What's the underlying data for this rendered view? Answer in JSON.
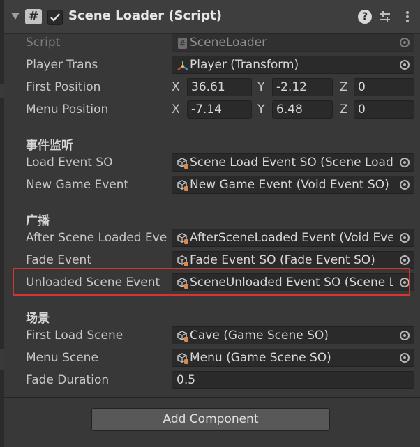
{
  "component": {
    "title": "Scene Loader (Script)",
    "script_icon_glyph": "#",
    "enabled": true,
    "header_icons": [
      "help-icon",
      "presets-icon",
      "kebab-menu-icon"
    ]
  },
  "fields": {
    "script": {
      "label": "Script",
      "value": "SceneLoader",
      "icon": "script-icon"
    },
    "player_trans": {
      "label": "Player Trans",
      "value": "Player (Transform)",
      "icon": "transform-icon"
    },
    "first_position": {
      "label": "First Position",
      "x_label": "X",
      "x": "36.61",
      "y_label": "Y",
      "y": "-2.12",
      "z_label": "Z",
      "z": "0"
    },
    "menu_position": {
      "label": "Menu Position",
      "x_label": "X",
      "x": "-7.14",
      "y_label": "Y",
      "y": "6.48",
      "z_label": "Z",
      "z": "0"
    }
  },
  "sections": {
    "listen": {
      "header": "事件监听",
      "load_event": {
        "label": "Load Event SO",
        "value": "Scene Load Event SO (Scene Load",
        "icon": "scriptable-object-icon"
      },
      "new_game_event": {
        "label": "New Game Event",
        "value": "New Game Event (Void Event SO)",
        "icon": "scriptable-object-icon"
      }
    },
    "broadcast": {
      "header": "广播",
      "after_scene_loaded": {
        "label": "After Scene Loaded Eve",
        "value": "AfterSceneLoaded Event (Void Eve",
        "icon": "scriptable-object-icon"
      },
      "fade_event": {
        "label": "Fade Event",
        "value": "Fade Event SO (Fade Event SO)",
        "icon": "scriptable-object-icon"
      },
      "unloaded_scene_event": {
        "label": "Unloaded Scene Event",
        "value": "SceneUnloaded Event SO (Scene L",
        "icon": "scriptable-object-icon"
      }
    },
    "scene": {
      "header": "场景",
      "first_load_scene": {
        "label": "First Load Scene",
        "value": "Cave (Game Scene SO)",
        "icon": "scriptable-object-icon"
      },
      "menu_scene": {
        "label": "Menu Scene",
        "value": "Menu (Game Scene SO)",
        "icon": "scriptable-object-icon"
      },
      "fade_duration": {
        "label": "Fade Duration",
        "value": "0.5"
      }
    }
  },
  "add_component_label": "Add Component",
  "highlight_color": "#d73333"
}
